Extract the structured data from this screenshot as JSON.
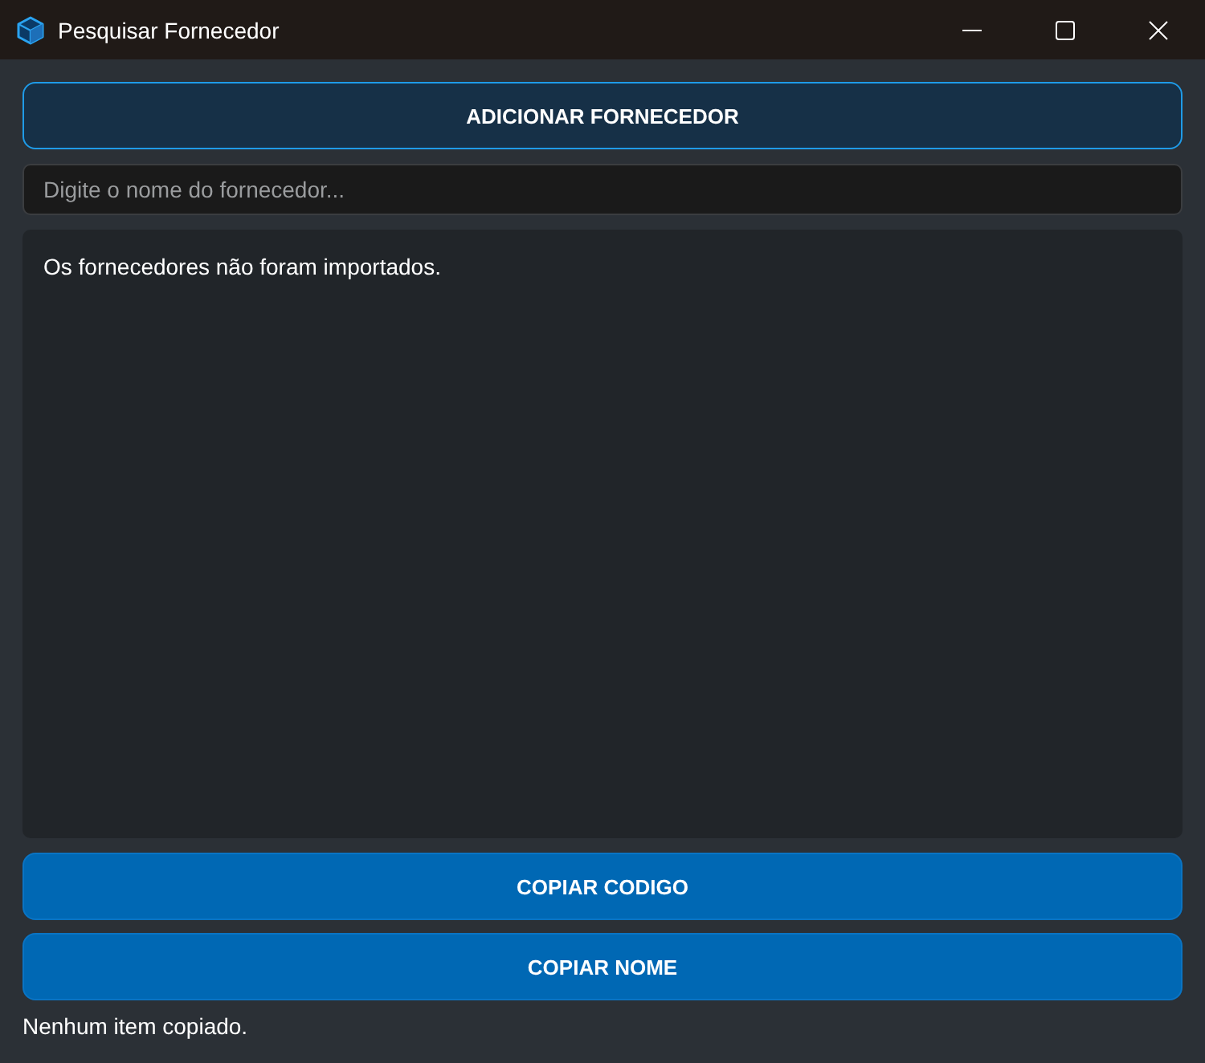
{
  "window": {
    "title": "Pesquisar Fornecedor"
  },
  "add_button": {
    "label": "ADICIONAR FORNECEDOR"
  },
  "search": {
    "placeholder": "Digite o nome do fornecedor..."
  },
  "results": {
    "message": "Os fornecedores não foram importados."
  },
  "buttons": [
    {
      "label": "COPIAR CODIGO"
    },
    {
      "label": "COPIAR NOME"
    }
  ],
  "status": "Nenhum item copiado."
}
